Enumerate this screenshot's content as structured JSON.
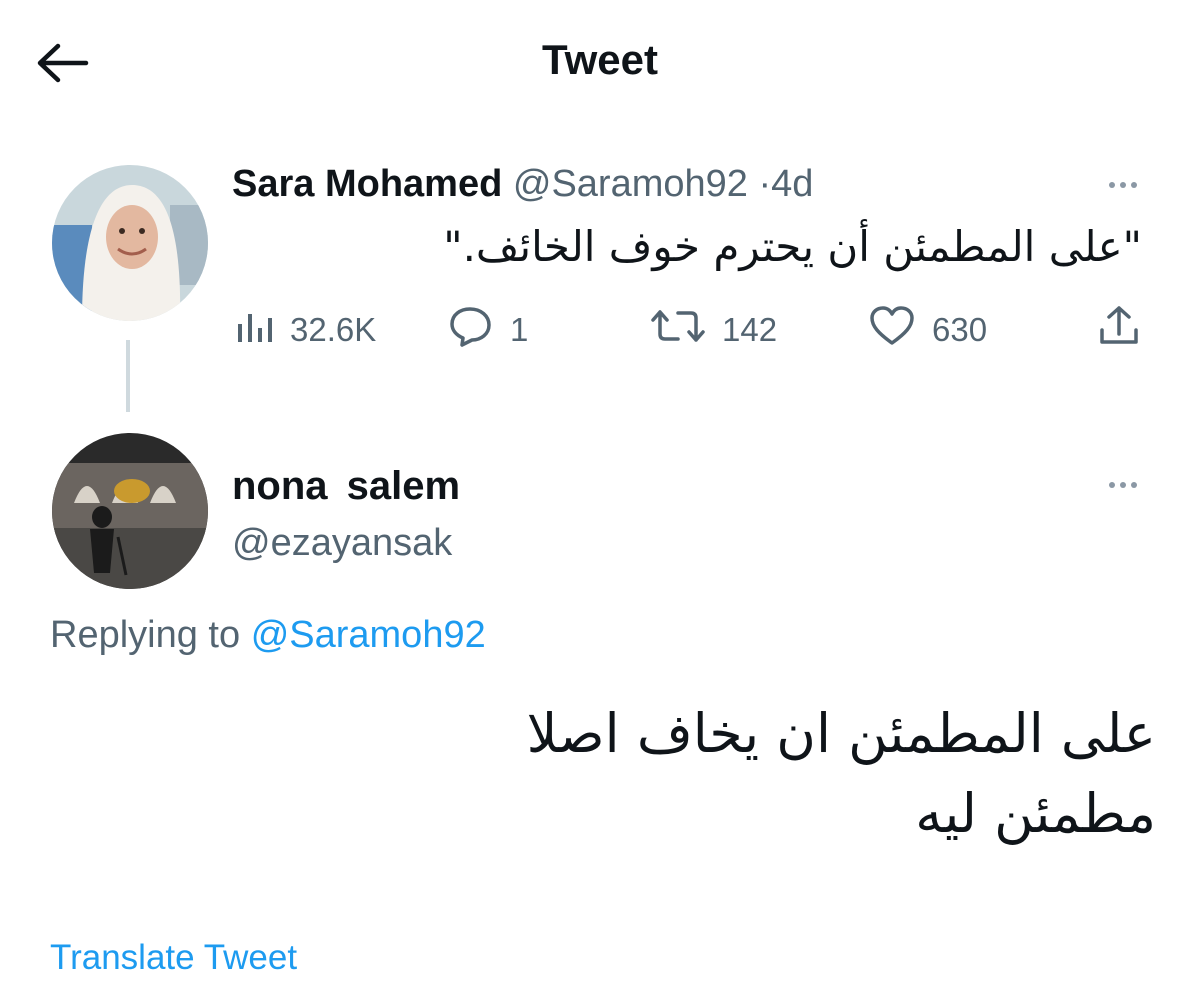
{
  "header": {
    "title": "Tweet",
    "back_icon": "arrow-left-icon"
  },
  "tweet": {
    "author_name": "Sara Mohamed",
    "author_handle": "@Saramoh92",
    "separator": "·",
    "time": "4d",
    "text": "\"على المطمئن أن يحترم خوف الخائف.\"",
    "stats": {
      "views": "32.6K",
      "replies": "1",
      "retweets": "142",
      "likes": "630"
    },
    "icons": {
      "views": "analytics-icon",
      "replies": "reply-icon",
      "retweets": "retweet-icon",
      "likes": "heart-icon",
      "share": "share-icon",
      "more": "more-icon"
    }
  },
  "reply": {
    "author_name": "nona  salem",
    "author_handle": "@ezayansak",
    "replying_prefix": "Replying to",
    "replying_to": "@Saramoh92",
    "text_lines": [
      "على المطمئن ان يخاف اصلا",
      "مطمئن ليه"
    ],
    "translate_label": "Translate Tweet"
  },
  "colors": {
    "text": "#0f1419",
    "secondary": "#536471",
    "link": "#1d9bf0",
    "thread_line": "#cfd9de"
  }
}
